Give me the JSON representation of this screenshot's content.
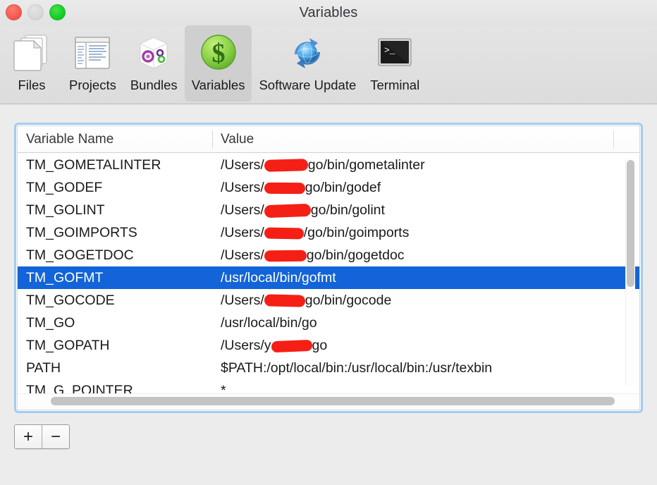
{
  "window": {
    "title": "Variables",
    "traffic_lights": [
      "close",
      "minimize",
      "zoom"
    ]
  },
  "toolbar": {
    "items": [
      {
        "label": "Files",
        "icon": "files-icon",
        "selected": false
      },
      {
        "label": "Projects",
        "icon": "projects-icon",
        "selected": false
      },
      {
        "label": "Bundles",
        "icon": "bundles-icon",
        "selected": false
      },
      {
        "label": "Variables",
        "icon": "variables-dollar-icon",
        "selected": true
      },
      {
        "label": "Software Update",
        "icon": "software-update-globe-icon",
        "selected": false
      },
      {
        "label": "Terminal",
        "icon": "terminal-icon",
        "selected": false
      }
    ]
  },
  "table": {
    "columns": [
      "Variable Name",
      "Value"
    ],
    "rows": [
      {
        "name": "TM_GOMETALINTER",
        "value_prefix": "/Users/",
        "redacted": true,
        "value_suffix": "go/bin/gometalinter",
        "selected": false
      },
      {
        "name": "TM_GODEF",
        "value_prefix": "/Users/",
        "redacted": true,
        "value_suffix": "go/bin/godef",
        "selected": false
      },
      {
        "name": "TM_GOLINT",
        "value_prefix": "/Users/",
        "redacted": true,
        "value_suffix": "go/bin/golint",
        "selected": false
      },
      {
        "name": "TM_GOIMPORTS",
        "value_prefix": "/Users/",
        "redacted": true,
        "value_suffix": "/go/bin/goimports",
        "selected": false
      },
      {
        "name": "TM_GOGETDOC",
        "value_prefix": "/Users/",
        "redacted": true,
        "value_suffix": "go/bin/gogetdoc",
        "selected": false
      },
      {
        "name": "TM_GOFMT",
        "value_prefix": "/usr/local/bin/gofmt",
        "redacted": false,
        "value_suffix": "",
        "selected": true
      },
      {
        "name": "TM_GOCODE",
        "value_prefix": "/Users/",
        "redacted": true,
        "value_suffix": "go/bin/gocode",
        "selected": false
      },
      {
        "name": "TM_GO",
        "value_prefix": "/usr/local/bin/go",
        "redacted": false,
        "value_suffix": "",
        "selected": false
      },
      {
        "name": "TM_GOPATH",
        "value_prefix": "/Users/y",
        "redacted": true,
        "value_suffix": "go",
        "selected": false
      },
      {
        "name": "PATH",
        "value_prefix": "$PATH:/opt/local/bin:/usr/local/bin:/usr/texbin",
        "redacted": false,
        "value_suffix": "",
        "selected": false
      },
      {
        "name": "TM_G_POINTER",
        "value_prefix": "*",
        "redacted": false,
        "value_suffix": "",
        "selected": false
      }
    ]
  },
  "footer": {
    "add_label": "+",
    "remove_label": "−"
  },
  "colors": {
    "selection_blue": "#1264d8",
    "focus_ring": "#a2cdf2",
    "redaction_red": "#f51f16",
    "window_chrome": "#e4e4e4"
  }
}
